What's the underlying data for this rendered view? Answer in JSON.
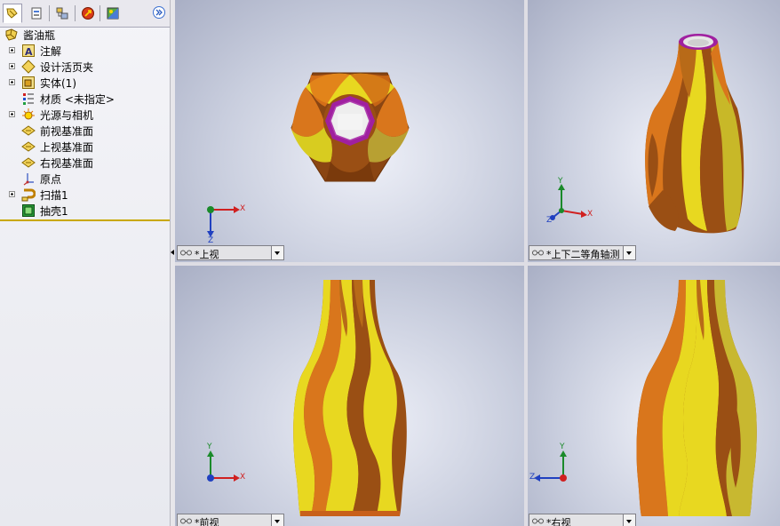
{
  "feature_tree": {
    "root": "酱油瓶",
    "items": [
      {
        "label": "注解",
        "expandable": true,
        "icon": "annotation-icon"
      },
      {
        "label": "设计活页夹",
        "expandable": true,
        "icon": "design-binder-icon"
      },
      {
        "label": "实体(1)",
        "expandable": true,
        "icon": "solid-body-icon"
      },
      {
        "label": "材质 <未指定>",
        "expandable": false,
        "icon": "material-icon"
      },
      {
        "label": "光源与相机",
        "expandable": true,
        "icon": "lights-cameras-icon"
      },
      {
        "label": "前视基准面",
        "expandable": false,
        "icon": "plane-icon"
      },
      {
        "label": "上视基准面",
        "expandable": false,
        "icon": "plane-icon"
      },
      {
        "label": "右视基准面",
        "expandable": false,
        "icon": "plane-icon"
      },
      {
        "label": "原点",
        "expandable": false,
        "icon": "origin-icon"
      },
      {
        "label": "扫描1",
        "expandable": true,
        "icon": "sweep-icon"
      },
      {
        "label": "抽壳1",
        "expandable": false,
        "icon": "shell-icon"
      }
    ]
  },
  "panel_tabs": [
    "feature-manager-tab",
    "property-manager-tab",
    "configuration-manager-tab",
    "dimxpert-tab",
    "display-manager-tab"
  ],
  "viewports": {
    "top": {
      "label": "*上视"
    },
    "iso": {
      "label": "*上下二等角轴测"
    },
    "front": {
      "label": "*前视"
    },
    "right": {
      "label": "*右视"
    }
  },
  "axes": {
    "x": "X",
    "y": "Y",
    "z": "Z"
  },
  "colors": {
    "orange": "#d9761c",
    "brown": "#9a4f14",
    "yellow": "#e8d820",
    "olive": "#b8a020",
    "rim": "#a020a0",
    "panel_accent": "#c9a800"
  }
}
